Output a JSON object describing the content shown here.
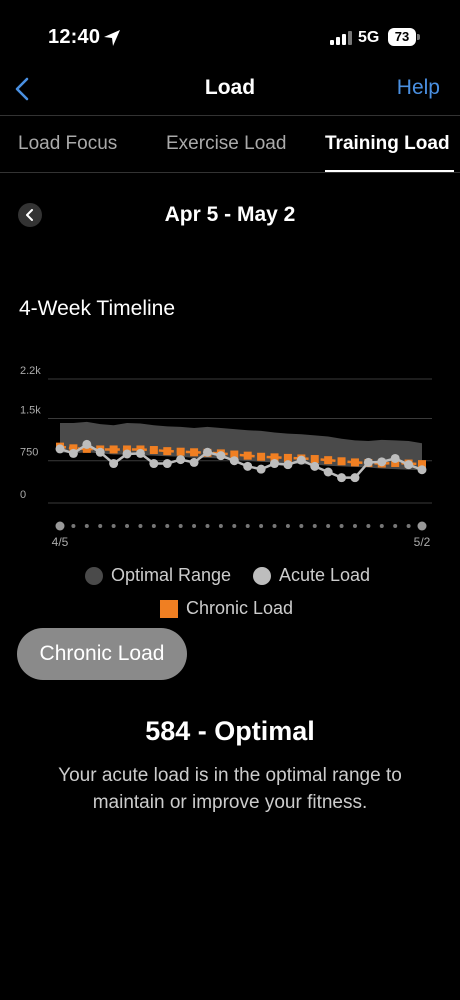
{
  "status": {
    "time": "12:40",
    "network": "5G",
    "battery": "73"
  },
  "header": {
    "title": "Load",
    "help_label": "Help"
  },
  "tabs": [
    {
      "label": "Load Focus",
      "selected": false
    },
    {
      "label": "Exercise Load",
      "selected": false
    },
    {
      "label": "Training Load",
      "selected": true
    }
  ],
  "date_range": "Apr 5 - May 2",
  "section_title": "4-Week Timeline",
  "chart_data": {
    "type": "line",
    "y_ticks": [
      "2.2k",
      "1.5k",
      "750",
      "0"
    ],
    "ylim": [
      0,
      2200
    ],
    "x_start_label": "4/5",
    "x_end_label": "5/2",
    "num_days": 28,
    "series": [
      {
        "name": "Optimal Range",
        "type": "area",
        "lower": [
          900,
          880,
          900,
          880,
          860,
          860,
          850,
          840,
          830,
          820,
          800,
          800,
          790,
          770,
          750,
          730,
          720,
          700,
          690,
          680,
          660,
          650,
          640,
          630,
          610,
          600,
          590,
          580
        ],
        "upper": [
          1420,
          1420,
          1440,
          1400,
          1380,
          1420,
          1410,
          1380,
          1360,
          1350,
          1330,
          1350,
          1330,
          1310,
          1290,
          1280,
          1250,
          1230,
          1220,
          1200,
          1180,
          1140,
          1110,
          1100,
          1120,
          1110,
          1100,
          1060
        ]
      },
      {
        "name": "Acute Load",
        "type": "line",
        "values": [
          960,
          880,
          1040,
          900,
          700,
          870,
          880,
          700,
          700,
          770,
          720,
          900,
          840,
          750,
          650,
          600,
          700,
          680,
          760,
          650,
          550,
          450,
          450,
          720,
          730,
          790,
          680,
          590
        ]
      },
      {
        "name": "Chronic Load",
        "type": "line",
        "values": [
          1000,
          970,
          960,
          950,
          950,
          950,
          950,
          940,
          920,
          910,
          900,
          890,
          880,
          860,
          840,
          820,
          810,
          800,
          790,
          780,
          760,
          740,
          720,
          710,
          700,
          710,
          700,
          690
        ]
      }
    ],
    "colors": {
      "range": "#4a4a4a",
      "acute": "#bdbdbd",
      "chronic": "#f07f22"
    }
  },
  "legend": {
    "range": "Optimal Range",
    "acute": "Acute Load",
    "chronic": "Chronic Load"
  },
  "chronic_button": "Chronic Load",
  "result": {
    "value": "584 - Optimal",
    "description": "Your acute load is in the optimal range to maintain or improve your fitness."
  }
}
